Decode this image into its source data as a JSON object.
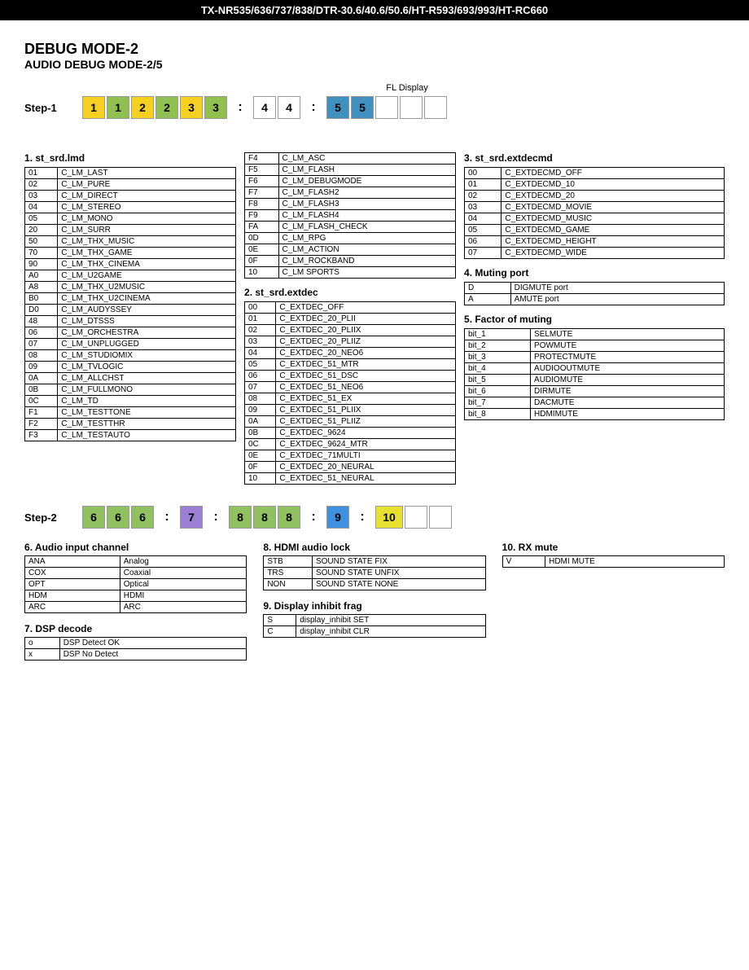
{
  "header": {
    "title": "TX-NR535/636/737/838/DTR-30.6/40.6/50.6/HT-R593/693/993/HT-RC660"
  },
  "page_title": {
    "line1": "DEBUG MODE-2",
    "line2": "AUDIO DEBUG MODE-2/5"
  },
  "step1": {
    "label": "Step-1",
    "fl_display": "FL Display",
    "digits": [
      {
        "val": "1",
        "color": "yellow"
      },
      {
        "val": "1",
        "color": "green"
      },
      {
        "val": "2",
        "color": "yellow"
      },
      {
        "val": "2",
        "color": "green"
      },
      {
        "val": "3",
        "color": "yellow"
      },
      {
        "val": "3",
        "color": "green"
      },
      {
        "sep": ":"
      },
      {
        "val": "4",
        "color": "white"
      },
      {
        "val": "4",
        "color": "white"
      },
      {
        "sep": ":"
      },
      {
        "val": "5",
        "color": "blue"
      },
      {
        "val": "5",
        "color": "blue"
      },
      {
        "empty": true
      },
      {
        "empty": true
      },
      {
        "empty": true
      }
    ]
  },
  "section1": {
    "title": "1. st_srd.lmd",
    "rows": [
      [
        "01",
        "C_LM_LAST"
      ],
      [
        "02",
        "C_LM_PURE"
      ],
      [
        "03",
        "C_LM_DIRECT"
      ],
      [
        "04",
        "C_LM_STEREO"
      ],
      [
        "05",
        "C_LM_MONO"
      ],
      [
        "20",
        "C_LM_SURR"
      ],
      [
        "50",
        "C_LM_THX_MUSIC"
      ],
      [
        "70",
        "C_LM_THX_GAME"
      ],
      [
        "90",
        "C_LM_THX_CINEMA"
      ],
      [
        "A0",
        "C_LM_U2GAME"
      ],
      [
        "A8",
        "C_LM_THX_U2MUSIC"
      ],
      [
        "B0",
        "C_LM_THX_U2CINEMA"
      ],
      [
        "D0",
        "C_LM_AUDYSSEY"
      ],
      [
        "48",
        "C_LM_DTSSS"
      ],
      [
        "06",
        "C_LM_ORCHESTRA"
      ],
      [
        "07",
        "C_LM_UNPLUGGED"
      ],
      [
        "08",
        "C_LM_STUDIOMIX"
      ],
      [
        "09",
        "C_LM_TVLOGIC"
      ],
      [
        "0A",
        "C_LM_ALLCHST"
      ],
      [
        "0B",
        "C_LM_FULLMONO"
      ],
      [
        "0C",
        "C_LM_TD"
      ],
      [
        "F1",
        "C_LM_TESTTONE"
      ],
      [
        "F2",
        "C_LM_TESTTHR"
      ],
      [
        "F3",
        "C_LM_TESTAUTO"
      ]
    ]
  },
  "section1b": {
    "rows": [
      [
        "F4",
        "C_LM_ASC"
      ],
      [
        "F5",
        "C_LM_FLASH"
      ],
      [
        "F6",
        "C_LM_DEBUGMODE"
      ],
      [
        "F7",
        "C_LM_FLASH2"
      ],
      [
        "F8",
        "C_LM_FLASH3"
      ],
      [
        "F9",
        "C_LM_FLASH4"
      ],
      [
        "FA",
        "C_LM_FLASH_CHECK"
      ],
      [
        "0D",
        "C_LM_RPG"
      ],
      [
        "0E",
        "C_LM_ACTION"
      ],
      [
        "0F",
        "C_LM_ROCKBAND"
      ],
      [
        "10",
        "C_LM  SPORTS"
      ]
    ]
  },
  "section2": {
    "title": "2. st_srd.extdec",
    "rows": [
      [
        "00",
        "C_EXTDEC_OFF"
      ],
      [
        "01",
        "C_EXTDEC_20_PLII"
      ],
      [
        "02",
        "C_EXTDEC_20_PLIIX"
      ],
      [
        "03",
        "C_EXTDEC_20_PLIIZ"
      ],
      [
        "04",
        "C_EXTDEC_20_NEO6"
      ],
      [
        "05",
        "C_EXTDEC_51_MTR"
      ],
      [
        "06",
        "C_EXTDEC_51_DSC"
      ],
      [
        "07",
        "C_EXTDEC_51_NEO6"
      ],
      [
        "08",
        "C_EXTDEC_51_EX"
      ],
      [
        "09",
        "C_EXTDEC_51_PLIIX"
      ],
      [
        "0A",
        "C_EXTDEC_51_PLIIZ"
      ],
      [
        "0B",
        "C_EXTDEC_9624"
      ],
      [
        "0C",
        "C_EXTDEC_9624_MTR"
      ],
      [
        "0E",
        "C_EXTDEC_71MULTI"
      ],
      [
        "0F",
        "C_EXTDEC_20_NEURAL"
      ],
      [
        "10",
        "C_EXTDEC_51_NEURAL"
      ]
    ]
  },
  "section3": {
    "title": "3. st_srd.extdecmd",
    "rows": [
      [
        "00",
        "C_EXTDECMD_OFF"
      ],
      [
        "01",
        "C_EXTDECMD_10"
      ],
      [
        "02",
        "C_EXTDECMD_20"
      ],
      [
        "03",
        "C_EXTDECMD_MOVIE"
      ],
      [
        "04",
        "C_EXTDECMD_MUSIC"
      ],
      [
        "05",
        "C_EXTDECMD_GAME"
      ],
      [
        "06",
        "C_EXTDECMD_HEIGHT"
      ],
      [
        "07",
        "C_EXTDECMD_WIDE"
      ]
    ]
  },
  "section4": {
    "title": "4. Muting port",
    "rows": [
      [
        "D",
        "DIGMUTE port"
      ],
      [
        "A",
        "AMUTE port"
      ]
    ]
  },
  "section5": {
    "title": "5. Factor of muting",
    "rows": [
      [
        "bit_1",
        "SELMUTE"
      ],
      [
        "bit_2",
        "POWMUTE"
      ],
      [
        "bit_3",
        "PROTECTMUTE"
      ],
      [
        "bit_4",
        "AUDIOOUTMUTE"
      ],
      [
        "bit_5",
        "AUDIOMUTE"
      ],
      [
        "bit_6",
        "DIRMUTE"
      ],
      [
        "bit_7",
        "DACMUTE"
      ],
      [
        "bit_8",
        "HDMIMUTE"
      ]
    ]
  },
  "step2": {
    "label": "Step-2",
    "digits": [
      {
        "val": "6",
        "color": "lgreen"
      },
      {
        "val": "6",
        "color": "lgreen"
      },
      {
        "val": "6",
        "color": "lgreen"
      },
      {
        "sep": ":"
      },
      {
        "val": "7",
        "color": "purple"
      },
      {
        "sep": ":"
      },
      {
        "val": "8",
        "color": "lgreen"
      },
      {
        "val": "8",
        "color": "lgreen"
      },
      {
        "val": "8",
        "color": "lgreen"
      },
      {
        "sep": ":"
      },
      {
        "val": "9",
        "color": "blue2"
      },
      {
        "sep": ":"
      },
      {
        "val": "10",
        "color": "yellow2"
      },
      {
        "empty": true
      },
      {
        "empty": true
      }
    ]
  },
  "section6": {
    "title": "6. Audio input channel",
    "rows": [
      [
        "ANA",
        "Analog"
      ],
      [
        "COX",
        "Coaxial"
      ],
      [
        "OPT",
        "Optical"
      ],
      [
        "HDM",
        "HDMI"
      ],
      [
        "ARC",
        "ARC"
      ]
    ]
  },
  "section7": {
    "title": "7. DSP decode",
    "rows": [
      [
        "o",
        "DSP Detect OK"
      ],
      [
        "x",
        "DSP No Detect"
      ]
    ]
  },
  "section8": {
    "title": "8. HDMI audio lock",
    "rows": [
      [
        "STB",
        "SOUND STATE FIX"
      ],
      [
        "TRS",
        "SOUND STATE UNFIX"
      ],
      [
        "NON",
        "SOUND STATE NONE"
      ]
    ]
  },
  "section9": {
    "title": "9. Display inhibit frag",
    "rows": [
      [
        "S",
        "display_inhibit SET"
      ],
      [
        "C",
        "display_inhibit CLR"
      ]
    ]
  },
  "section10": {
    "title": "10. RX mute",
    "rows": [
      [
        "V",
        "HDMI MUTE"
      ]
    ]
  }
}
